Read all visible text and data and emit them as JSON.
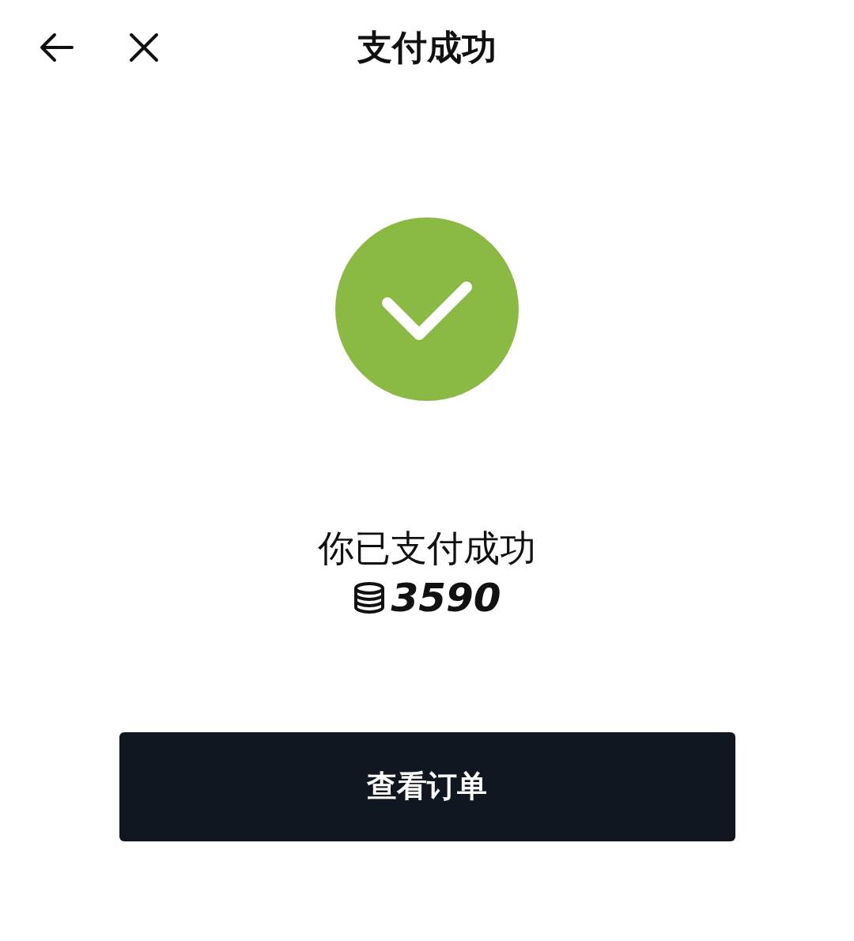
{
  "header": {
    "title": "支付成功"
  },
  "result": {
    "success": true,
    "message": "你已支付成功",
    "amount": "3590"
  },
  "button": {
    "label": "查看订单"
  }
}
